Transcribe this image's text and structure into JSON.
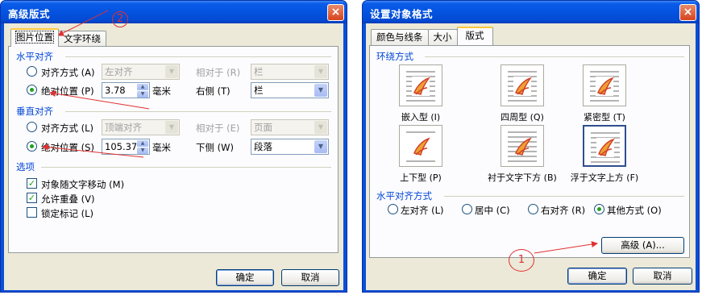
{
  "left_dialog": {
    "title": "高级版式",
    "close": "×",
    "tabs": [
      "图片位置",
      "文字环绕"
    ],
    "horizontal": {
      "group_title": "水平对齐",
      "align_label": "对齐方式 (A)",
      "align_value": "左对齐",
      "relative_label": "相对于 (R)",
      "relative_value": "栏",
      "absolute_label": "绝对位置 (P)",
      "absolute_value": "3.78",
      "unit": "毫米",
      "side_label": "右侧 (T)",
      "side_value": "栏"
    },
    "vertical": {
      "group_title": "垂直对齐",
      "align_label": "对齐方式 (L)",
      "align_value": "顶端对齐",
      "relative_label": "相对于 (E)",
      "relative_value": "页面",
      "absolute_label": "绝对位置 (S)",
      "absolute_value": "105.37",
      "unit": "毫米",
      "side_label": "下侧 (W)",
      "side_value": "段落"
    },
    "options": {
      "group_title": "选项",
      "items": [
        {
          "label": "对象随文字移动 (M)",
          "checked": true
        },
        {
          "label": "允许重叠 (V)",
          "checked": true
        },
        {
          "label": "锁定标记 (L)",
          "checked": false
        }
      ]
    },
    "ok": "确定",
    "cancel": "取消"
  },
  "right_dialog": {
    "title": "设置对象格式",
    "close": "×",
    "tabs": [
      "颜色与线条",
      "大小",
      "版式"
    ],
    "wrap_group_title": "环绕方式",
    "wrap_styles": [
      {
        "label": "嵌入型 (I)",
        "icon": "inline-wrap-icon"
      },
      {
        "label": "四周型 (Q)",
        "icon": "square-wrap-icon"
      },
      {
        "label": "紧密型 (T)",
        "icon": "tight-wrap-icon"
      },
      {
        "label": "上下型 (P)",
        "icon": "top-bottom-wrap-icon"
      },
      {
        "label": "衬于文字下方 (B)",
        "icon": "behind-text-icon"
      },
      {
        "label": "浮于文字上方 (F)",
        "icon": "in-front-of-text-icon",
        "selected": true
      }
    ],
    "halign_group_title": "水平对齐方式",
    "halign_options": [
      {
        "label": "左对齐 (L)",
        "selected": false
      },
      {
        "label": "居中 (C)",
        "selected": false
      },
      {
        "label": "右对齐 (R)",
        "selected": false
      },
      {
        "label": "其他方式 (O)",
        "selected": true
      }
    ],
    "advanced": "高级 (A)...",
    "ok": "确定",
    "cancel": "取消"
  },
  "annotations": {
    "step1": "1",
    "step2": "2",
    "color": "#e03030"
  },
  "colors": {
    "titlebar": "#0453e0",
    "dialog_face": "#ece9d8",
    "group_title": "#0046d5",
    "radio_dot": "#21a121"
  }
}
